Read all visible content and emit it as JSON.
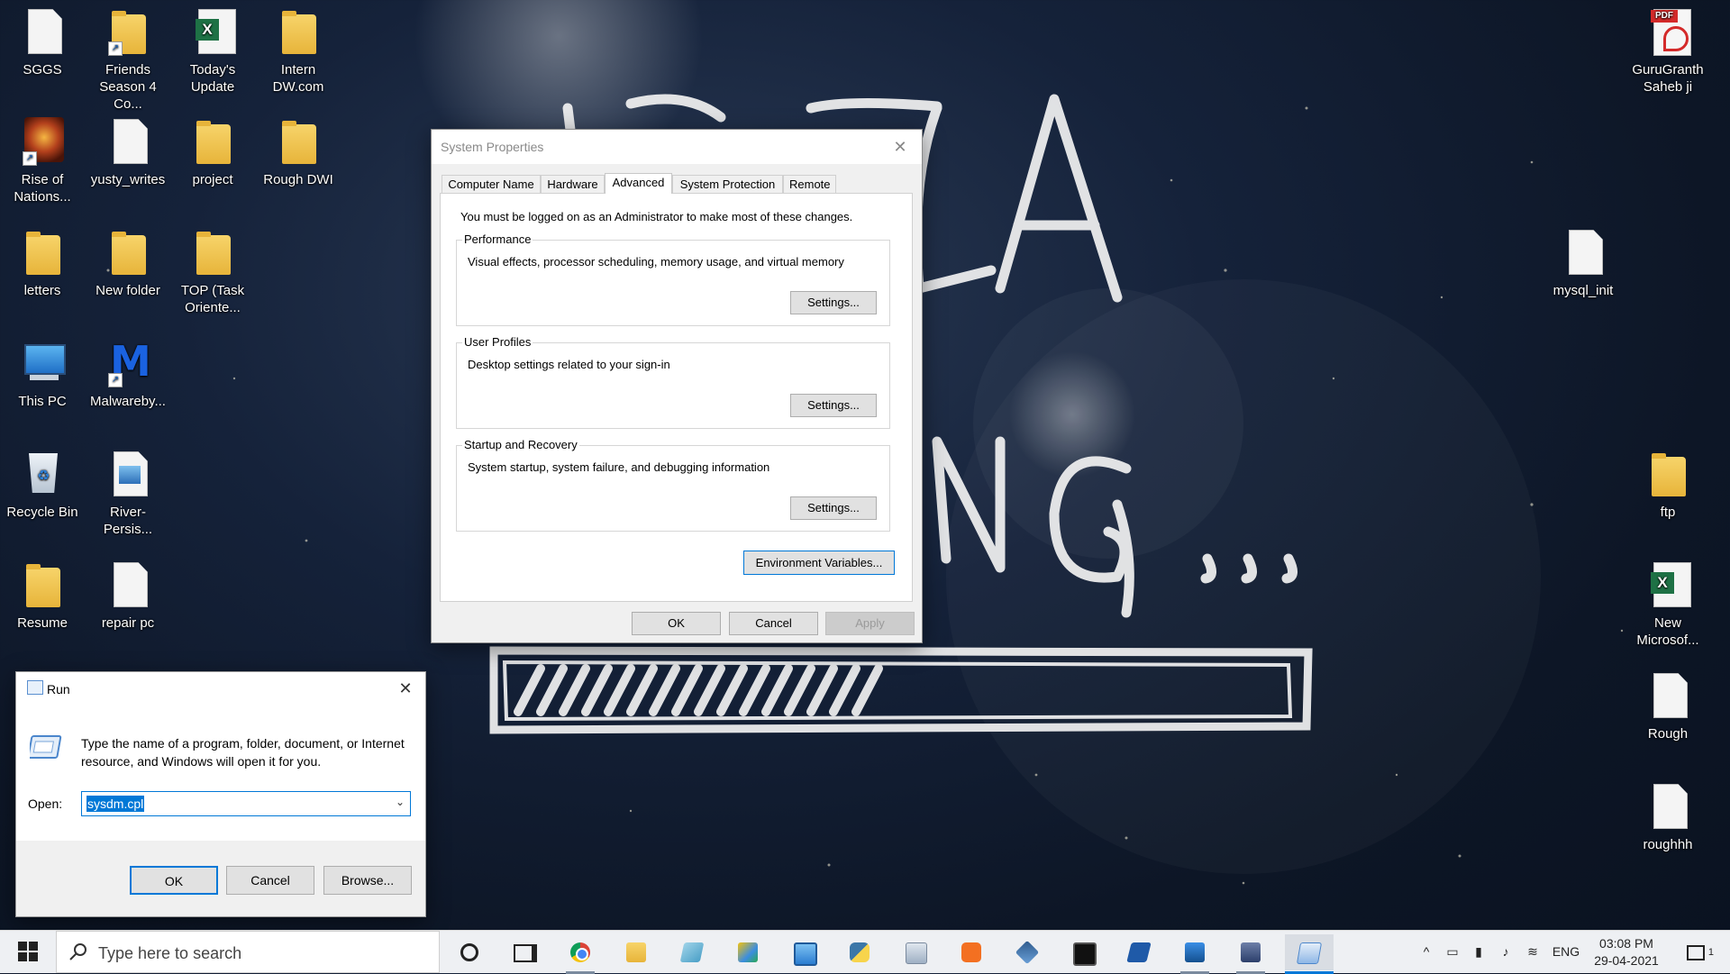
{
  "desktop": {
    "icons": [
      {
        "label": "SGGS",
        "type": "doc"
      },
      {
        "label": "Friends\nSeason 4 Co...",
        "type": "folder-shortcut"
      },
      {
        "label": "Today's\nUpdate",
        "type": "excel"
      },
      {
        "label": "Intern\nDW.com",
        "type": "folder"
      },
      {
        "label": "Rise of\nNations...",
        "type": "game-shortcut"
      },
      {
        "label": "yusty_writes",
        "type": "doc"
      },
      {
        "label": "project",
        "type": "folder"
      },
      {
        "label": "Rough DWI",
        "type": "folder"
      },
      {
        "label": "letters",
        "type": "folder"
      },
      {
        "label": "New folder",
        "type": "folder"
      },
      {
        "label": "TOP (Task\nOriente...",
        "type": "folder"
      },
      {
        "label": "This PC",
        "type": "this-pc"
      },
      {
        "label": "Malwareby...",
        "type": "malwarebytes-shortcut"
      },
      {
        "label": "Recycle Bin",
        "type": "recycle-bin"
      },
      {
        "label": "River-Persis...",
        "type": "image"
      },
      {
        "label": "Resume",
        "type": "folder"
      },
      {
        "label": "repair pc",
        "type": "doc"
      },
      {
        "label": "GuruGranth\nSaheb ji",
        "type": "pdf"
      },
      {
        "label": "mysql_init",
        "type": "doc"
      },
      {
        "label": "ftp",
        "type": "folder"
      },
      {
        "label": "New\nMicrosof...",
        "type": "excel"
      },
      {
        "label": "Rough",
        "type": "doc"
      },
      {
        "label": "roughhh",
        "type": "doc"
      }
    ]
  },
  "system_properties": {
    "title": "System Properties",
    "close_glyph": "✕",
    "tabs": [
      {
        "label": "Computer Name",
        "active": false
      },
      {
        "label": "Hardware",
        "active": false
      },
      {
        "label": "Advanced",
        "active": true
      },
      {
        "label": "System Protection",
        "active": false
      },
      {
        "label": "Remote",
        "active": false
      }
    ],
    "admin_note": "You must be logged on as an Administrator to make most of these changes.",
    "groups": [
      {
        "title": "Performance",
        "description": "Visual effects, processor scheduling, memory usage, and virtual memory",
        "button": "Settings..."
      },
      {
        "title": "User Profiles",
        "description": "Desktop settings related to your sign-in",
        "button": "Settings..."
      },
      {
        "title": "Startup and Recovery",
        "description": "System startup, system failure, and debugging information",
        "button": "Settings..."
      }
    ],
    "env_button": "Environment Variables...",
    "ok": "OK",
    "cancel": "Cancel",
    "apply": "Apply"
  },
  "run_dialog": {
    "title": "Run",
    "close_glyph": "✕",
    "description": "Type the name of a program, folder, document, or Internet resource, and Windows will open it for you.",
    "open_label": "Open:",
    "open_value": "sysdm.cpl",
    "ok": "OK",
    "cancel": "Cancel",
    "browse": "Browse..."
  },
  "taskbar": {
    "search_placeholder": "Type here to search",
    "apps": [
      "task-view",
      "chrome",
      "file-explorer",
      "notepad",
      "snipping",
      "control-panel",
      "python",
      "photos-gallery",
      "xampp",
      "virtualbox",
      "terminal",
      "powershell",
      "photos",
      "network-app",
      "run"
    ],
    "tray": {
      "language": "ENG",
      "time": "03:08 PM",
      "date": "29-04-2021",
      "notification_count": "1"
    },
    "colors": {
      "accent": "#0078d7",
      "taskbar_bg": "#eef0f3"
    }
  }
}
